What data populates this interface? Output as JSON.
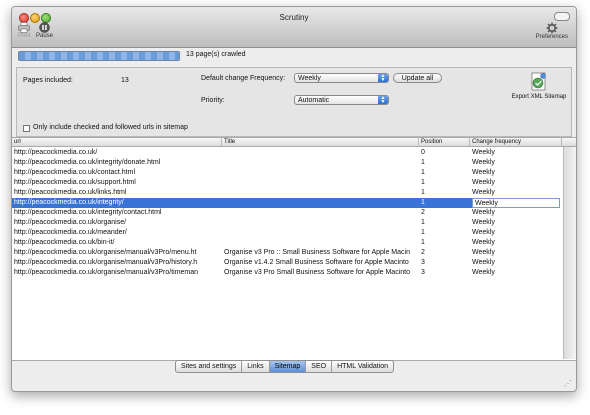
{
  "window": {
    "title": "Scrutiny"
  },
  "toolbar": {
    "print_label": "Print",
    "pause_label": "Pause",
    "preferences_label": "Preferences"
  },
  "progress": {
    "fraction": 1.0,
    "text": "13 page(s) crawled"
  },
  "settings": {
    "pages_included_label": "Pages included:",
    "pages_included_value": "13",
    "default_freq_label": "Default change Frequency:",
    "default_freq_value": "Weekly",
    "update_all_label": "Update all",
    "priority_label": "Priority:",
    "priority_value": "Automatic",
    "export_label": "Export XML Sitemap",
    "only_checked_label": "Only include checked and followed urls in sitemap"
  },
  "table": {
    "columns": [
      "url",
      "Title",
      "Position",
      "Change frequency"
    ],
    "rows": [
      {
        "url": "http://peacockmedia.co.uk/",
        "title": "",
        "position": "0",
        "freq": "Weekly"
      },
      {
        "url": "http://peacockmedia.co.uk/integrity/donate.html",
        "title": "",
        "position": "1",
        "freq": "Weekly"
      },
      {
        "url": "http://peacockmedia.co.uk/contact.html",
        "title": "",
        "position": "1",
        "freq": "Weekly"
      },
      {
        "url": "http://peacockmedia.co.uk/support.html",
        "title": "",
        "position": "1",
        "freq": "Weekly"
      },
      {
        "url": "http://peacockmedia.co.uk/links.html",
        "title": "",
        "position": "1",
        "freq": "Weekly"
      },
      {
        "url": "http://peacockmedia.co.uk/integrity/",
        "title": "",
        "position": "1",
        "freq": "Weekly"
      },
      {
        "url": "http://peacockmedia.co.uk/integrity/contact.html",
        "title": "",
        "position": "2",
        "freq": "Weekly"
      },
      {
        "url": "http://peacockmedia.co.uk/organise/",
        "title": "",
        "position": "1",
        "freq": "Weekly"
      },
      {
        "url": "http://peacockmedia.co.uk/meander/",
        "title": "",
        "position": "1",
        "freq": "Weekly"
      },
      {
        "url": "http://peacockmedia.co.uk/bin-it/",
        "title": "",
        "position": "1",
        "freq": "Weekly"
      },
      {
        "url": "http://peacockmedia.co.uk/organise/manual/v3Pro/menu.ht",
        "title": "Organise v3 Pro :: Small Business Software for Apple Macin",
        "position": "2",
        "freq": "Weekly"
      },
      {
        "url": "http://peacockmedia.co.uk/organise/manual/v3Pro/history.h",
        "title": "Organise v1.4.2 Small Business Software for Apple Macinto",
        "position": "3",
        "freq": "Weekly"
      },
      {
        "url": "http://peacockmedia.co.uk/organise/manual/v3Pro/timeman",
        "title": "Organise v3 Pro Small Business Software for Apple Macinto",
        "position": "3",
        "freq": "Weekly"
      }
    ],
    "selected_row": 5
  },
  "tabs": [
    "Sites and settings",
    "Links",
    "Sitemap",
    "SEO",
    "HTML Validation"
  ],
  "active_tab": "Sitemap",
  "colors": {
    "selection": "#3874d8",
    "accent": "#5d90d8"
  }
}
